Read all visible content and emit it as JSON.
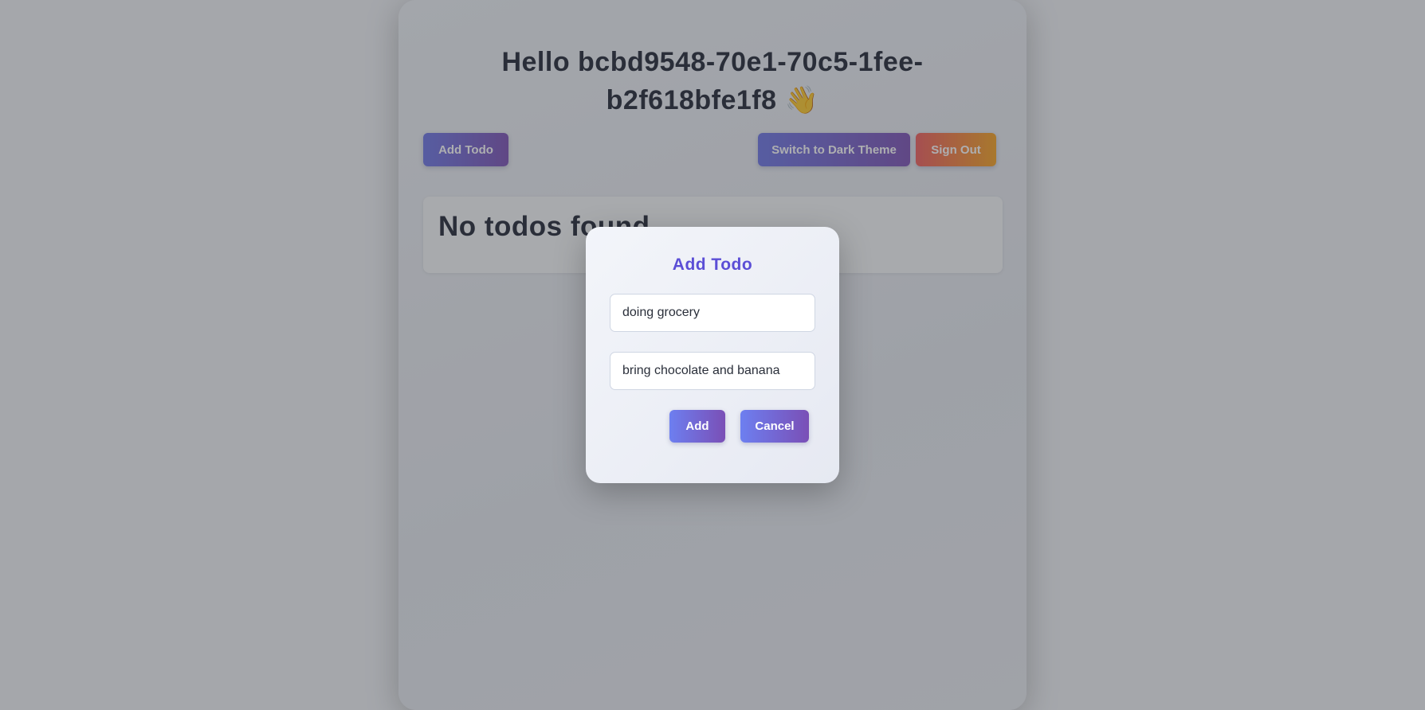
{
  "header": {
    "greeting_line1": "Hello bcbd9548-70e1-70c5-1fee-",
    "greeting_line2": "b2f618bfe1f8",
    "wave_emoji": "👋"
  },
  "toolbar": {
    "add_todo_label": "Add Todo",
    "theme_toggle_label": "Switch to Dark Theme",
    "sign_out_label": "Sign Out"
  },
  "todos": {
    "empty_message": "No todos found"
  },
  "modal": {
    "title": "Add Todo",
    "title_value": "doing grocery",
    "description_value": "bring chocolate and banana",
    "add_label": "Add",
    "cancel_label": "Cancel"
  },
  "colors": {
    "accent": "#5b4ed6",
    "button_gradient_start": "#6b74e6",
    "button_gradient_end": "#7b4fb5",
    "signout_gradient_start": "#f25b5b",
    "signout_gradient_end": "#f6a21f"
  }
}
